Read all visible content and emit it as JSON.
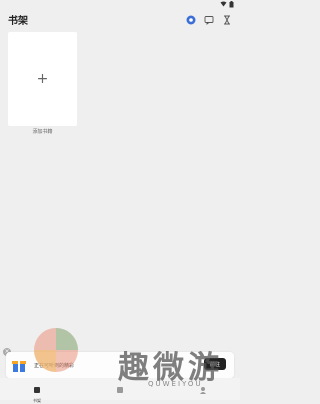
{
  "header": {
    "title": "书架"
  },
  "bookshelf": {
    "add_label": "添加书籍",
    "plus": "+"
  },
  "ad": {
    "close": "×",
    "text": "正在可听到的精彩",
    "cta": "前往"
  },
  "nav": {
    "items": [
      {
        "label": "书架"
      },
      {
        "label": ""
      },
      {
        "label": ""
      }
    ]
  },
  "watermark": {
    "text": "趣微游",
    "sub": "QUWEIYOU"
  },
  "colors": {
    "accent": "#3b6fd6",
    "banner_cta": "#222222",
    "background": "#efefef"
  }
}
